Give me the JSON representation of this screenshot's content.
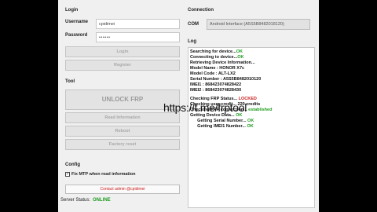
{
  "login": {
    "section_title": "Login",
    "username_label": "Username",
    "username_value": "cpidimei",
    "password_label": "Password",
    "password_value": "••••••",
    "login_button": "Login",
    "register_button": "Register"
  },
  "connection": {
    "section_title": "Connection",
    "com_label": "COM",
    "com_value": "Android Interface (A5S5B8482018120)"
  },
  "tool": {
    "section_title": "Tool",
    "unlock_button": "UNLOCK FRP",
    "read_info_button": "Read Information",
    "reboot_button": "Reboot",
    "factory_reset_button": "Factory reset"
  },
  "config": {
    "section_title": "Config",
    "fix_mtp_checked": true,
    "fix_mtp_label": "Fix MTP when read information",
    "contact_text": "Contact admin @cpidimei"
  },
  "server": {
    "label": "Server Status:",
    "status": "ONLINE"
  },
  "log": {
    "section_title": "Log",
    "lines": [
      {
        "text": "Searching for device...",
        "status": "OK"
      },
      {
        "text": "Connecting to device...",
        "status": "OK"
      },
      {
        "text": "Retrieving Device Information...",
        "status": ""
      },
      {
        "text": "Model Name : HONOR X7c",
        "status": ""
      },
      {
        "text": "Model Code : ALT-LX2",
        "status": ""
      },
      {
        "text": "Serial Number : A5S5B8482010120",
        "status": ""
      },
      {
        "text": "IMEI1 : 868423074828422",
        "status": ""
      },
      {
        "text": "IMEI2 : 868423074828430",
        "status": ""
      },
      {
        "text": "",
        "status": ""
      },
      {
        "text": "Checking FRP Status... ",
        "status": "LOCKED"
      },
      {
        "text": "Checking user credit... 220 credits",
        "status": ""
      },
      {
        "text": "Checking FRP connection... ",
        "status": "established"
      },
      {
        "text": "Getting Device Data... ",
        "status": "OK"
      },
      {
        "text": "      Getting Serial Number... ",
        "status": "OK"
      },
      {
        "text": "      Getting IMEI1 Number... ",
        "status": "OK"
      }
    ]
  },
  "watermark": {
    "text": "https://t.me/frptool"
  }
}
